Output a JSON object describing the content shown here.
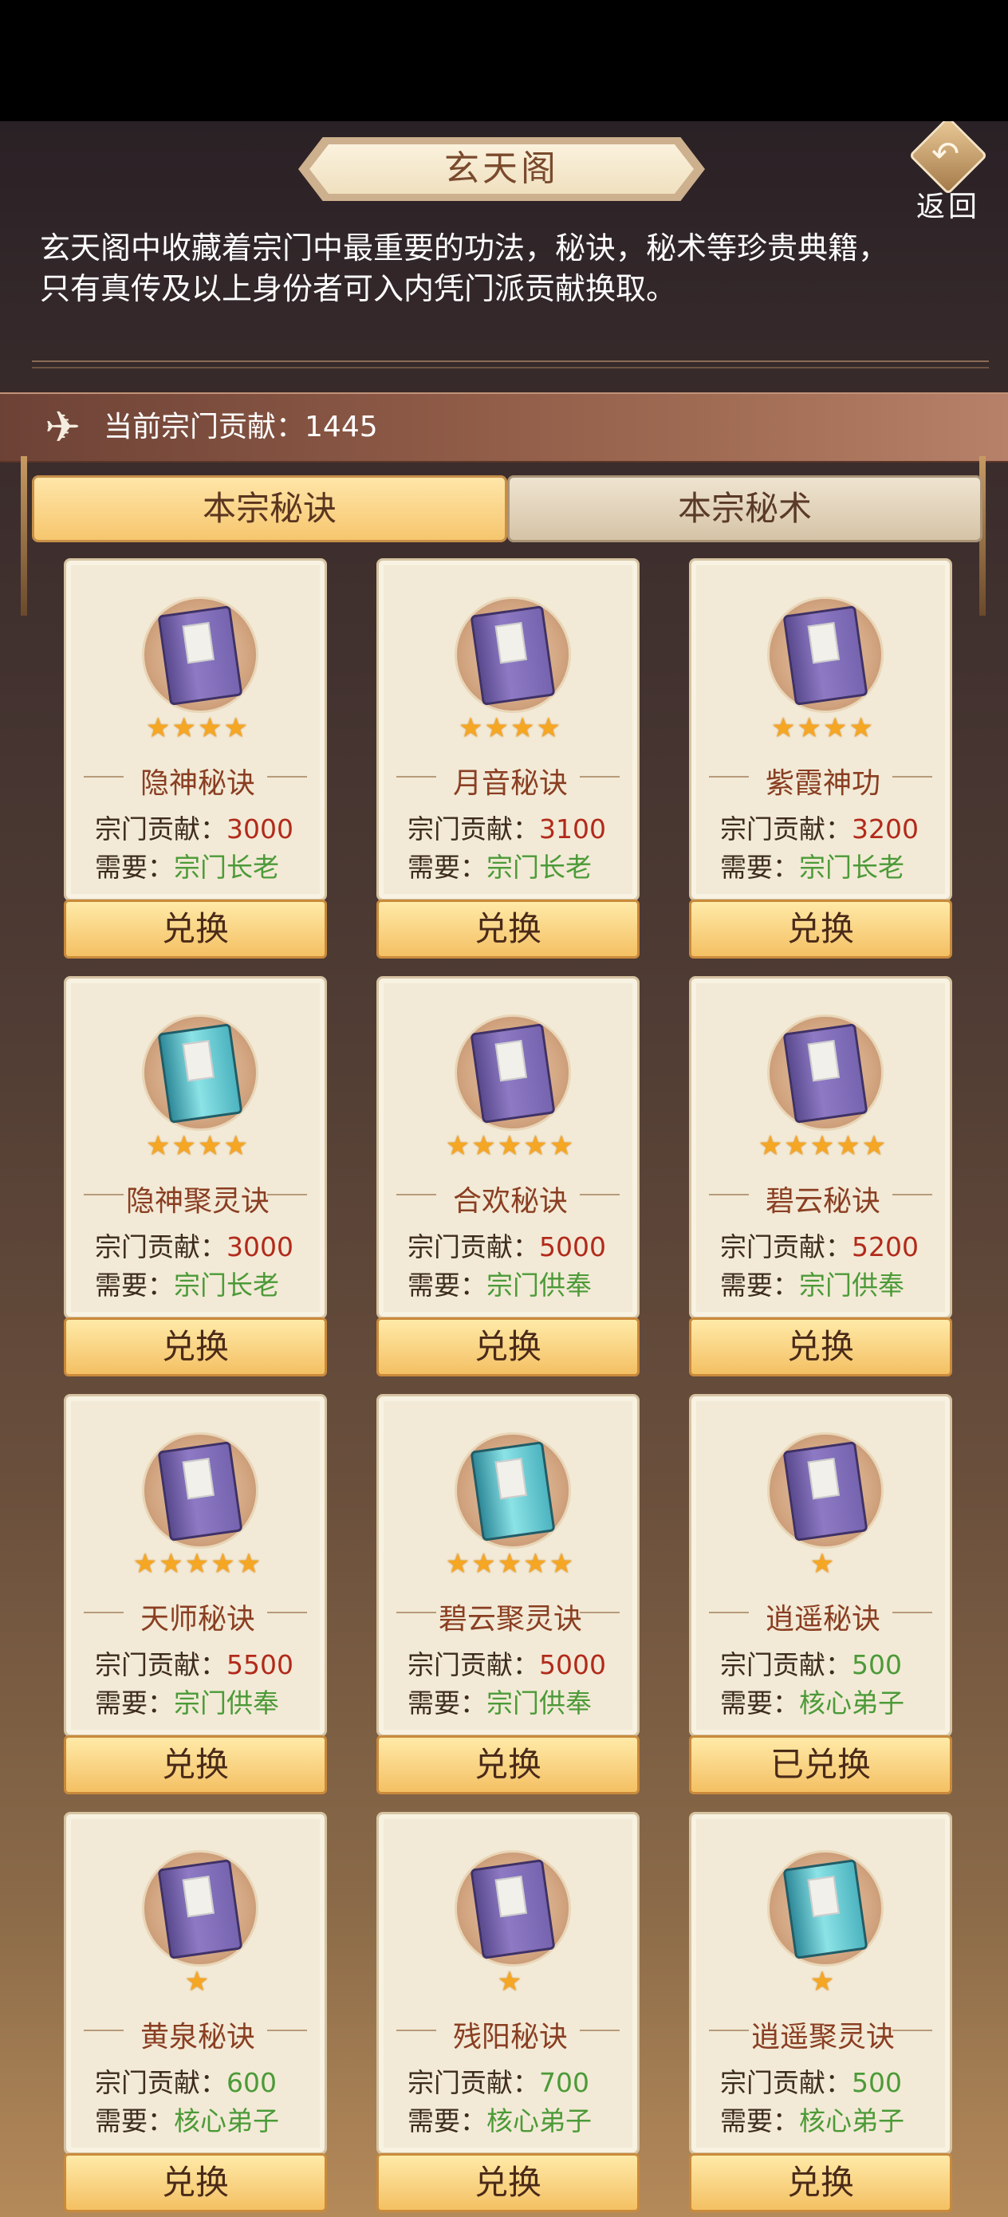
{
  "header": {
    "title": "玄天阁",
    "back_label": "返回",
    "description_lines": [
      "玄天阁中收藏着宗门中最重要的功法，秘诀，秘术等珍贵典籍，",
      "只有真传及以上身份者可入内凭门派贡献换取。"
    ]
  },
  "contribution": {
    "label": "当前宗门贡献：",
    "value": "1445"
  },
  "tabs": [
    {
      "label": "本宗秘诀",
      "active": true
    },
    {
      "label": "本宗秘术",
      "active": false
    }
  ],
  "items": [
    {
      "name": "隐神秘诀",
      "stars": "★★★★",
      "cost_label": "宗门贡献：",
      "cost": "3000",
      "req_label": "需要：",
      "req": "宗门长老",
      "button": "兑换",
      "book": "purple",
      "affordable": false
    },
    {
      "name": "月音秘诀",
      "stars": "★★★★",
      "cost_label": "宗门贡献：",
      "cost": "3100",
      "req_label": "需要：",
      "req": "宗门长老",
      "button": "兑换",
      "book": "purple",
      "affordable": false
    },
    {
      "name": "紫霞神功",
      "stars": "★★★★",
      "cost_label": "宗门贡献：",
      "cost": "3200",
      "req_label": "需要：",
      "req": "宗门长老",
      "button": "兑换",
      "book": "purple",
      "affordable": false
    },
    {
      "name": "隐神聚灵诀",
      "stars": "★★★★",
      "cost_label": "宗门贡献：",
      "cost": "3000",
      "req_label": "需要：",
      "req": "宗门长老",
      "button": "兑换",
      "book": "teal",
      "affordable": false
    },
    {
      "name": "合欢秘诀",
      "stars": "★★★★★",
      "cost_label": "宗门贡献：",
      "cost": "5000",
      "req_label": "需要：",
      "req": "宗门供奉",
      "button": "兑换",
      "book": "purple",
      "affordable": false
    },
    {
      "name": "碧云秘诀",
      "stars": "★★★★★",
      "cost_label": "宗门贡献：",
      "cost": "5200",
      "req_label": "需要：",
      "req": "宗门供奉",
      "button": "兑换",
      "book": "purple",
      "affordable": false
    },
    {
      "name": "天师秘诀",
      "stars": "★★★★★",
      "cost_label": "宗门贡献：",
      "cost": "5500",
      "req_label": "需要：",
      "req": "宗门供奉",
      "button": "兑换",
      "book": "purple",
      "affordable": false
    },
    {
      "name": "碧云聚灵诀",
      "stars": "★★★★★",
      "cost_label": "宗门贡献：",
      "cost": "5000",
      "req_label": "需要：",
      "req": "宗门供奉",
      "button": "兑换",
      "book": "teal",
      "affordable": false
    },
    {
      "name": "逍遥秘诀",
      "stars": "★",
      "cost_label": "宗门贡献：",
      "cost": "500",
      "req_label": "需要：",
      "req": "核心弟子",
      "button": "已兑换",
      "book": "purple",
      "affordable": true
    },
    {
      "name": "黄泉秘诀",
      "stars": "★",
      "cost_label": "宗门贡献：",
      "cost": "600",
      "req_label": "需要：",
      "req": "核心弟子",
      "button": "兑换",
      "book": "purple",
      "affordable": true
    },
    {
      "name": "残阳秘诀",
      "stars": "★",
      "cost_label": "宗门贡献：",
      "cost": "700",
      "req_label": "需要：",
      "req": "核心弟子",
      "button": "兑换",
      "book": "purple",
      "affordable": true
    },
    {
      "name": "逍遥聚灵诀",
      "stars": "★",
      "cost_label": "宗门贡献：",
      "cost": "500",
      "req_label": "需要：",
      "req": "核心弟子",
      "button": "兑换",
      "book": "teal",
      "affordable": true
    }
  ],
  "colors": {
    "cost_unaffordable": "#b22a1b",
    "cost_affordable": "#4c9a38",
    "requirement": "#4c9a38",
    "button": "#f4c063"
  }
}
